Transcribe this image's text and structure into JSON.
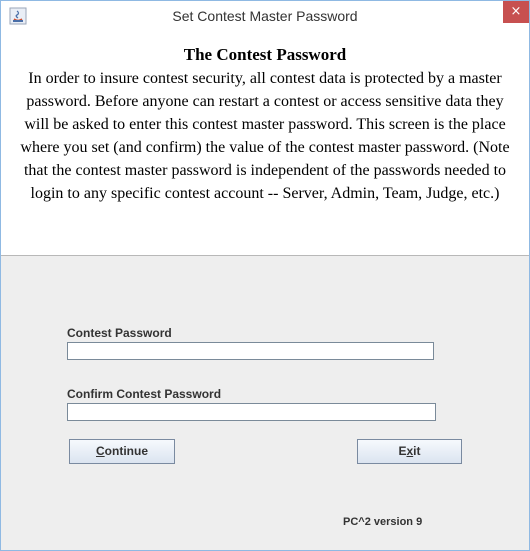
{
  "window": {
    "title": "Set Contest Master Password",
    "close_glyph": "×"
  },
  "info": {
    "title": "The Contest Password",
    "body": "In order to insure contest security, all contest data is protected by a master password. Before anyone can restart a contest or access sensitive data they will be asked to enter this contest master password. This screen is the place where you set (and confirm) the value of the contest master password. (Note that the contest master password is independent of the passwords needed to login to any specific contest account -- Server, Admin, Team, Judge, etc.)"
  },
  "form": {
    "password_label": "Contest Password",
    "password_value": "",
    "confirm_label": "Confirm Contest Password",
    "confirm_value": ""
  },
  "buttons": {
    "continue_mnemonic": "C",
    "continue_rest": "ontinue",
    "exit_pre": "E",
    "exit_mnemonic": "x",
    "exit_rest": "it"
  },
  "footer": {
    "version": "PC^2 version 9"
  }
}
